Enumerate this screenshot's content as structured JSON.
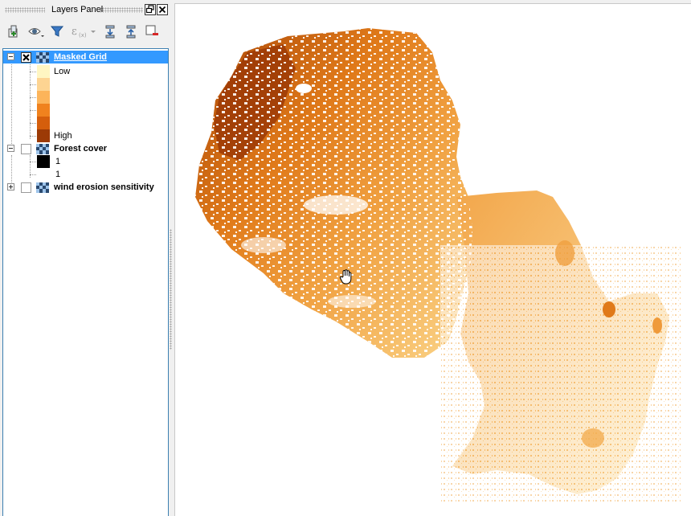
{
  "panel": {
    "title": "Layers Panel",
    "buttons": {
      "float": "float-icon",
      "close": "close-icon"
    }
  },
  "toolbar": {
    "icons": [
      "add-group-icon",
      "visibility-icon",
      "filter-icon",
      "expression-filter-icon",
      "expand-all-icon",
      "collapse-all-icon",
      "remove-layer-icon"
    ]
  },
  "layers": [
    {
      "name": "Masked Grid",
      "checked": true,
      "expanded": true,
      "selected": true,
      "legend": [
        {
          "label": "Low",
          "color": "#fff6c2"
        },
        {
          "label": "",
          "color": "#fdd492"
        },
        {
          "label": "",
          "color": "#fcb45a"
        },
        {
          "label": "",
          "color": "#f0821e"
        },
        {
          "label": "",
          "color": "#d55e0c"
        },
        {
          "label": "High",
          "color": "#9c3a06"
        }
      ]
    },
    {
      "name": "Forest cover",
      "checked": false,
      "expanded": true,
      "selected": false,
      "legend": [
        {
          "label": "1",
          "color": "#000000"
        },
        {
          "label": "1",
          "color": "#ffffff"
        }
      ]
    },
    {
      "name": "wind erosion sensitivity",
      "checked": false,
      "expanded": false,
      "selected": false,
      "legend": []
    }
  ],
  "colors": {
    "selection": "#3399ff",
    "ramp_low": "#fff6c2",
    "ramp_high": "#9c3a06"
  },
  "map": {
    "cursor_icon": "hand-pan-icon"
  }
}
